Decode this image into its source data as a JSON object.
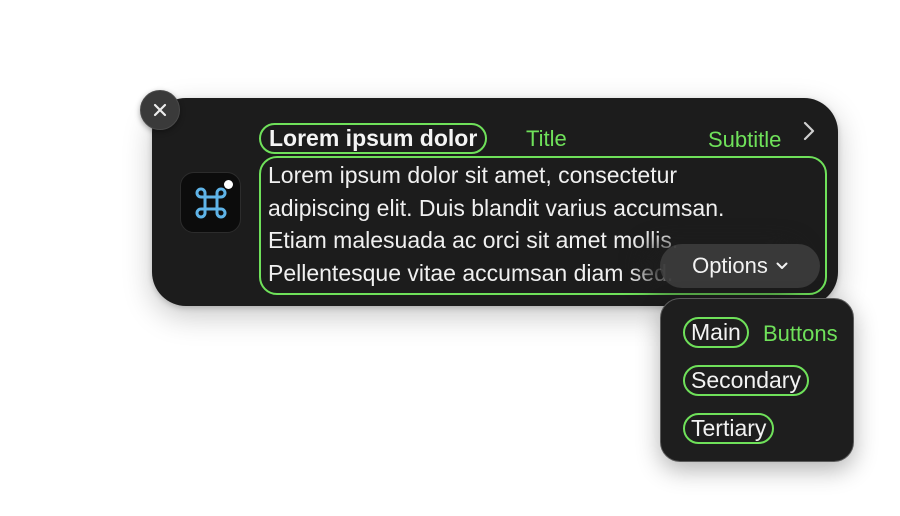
{
  "notification": {
    "title": "Lorem ipsum dolor",
    "title_annotation": "Title",
    "subtitle": "Subtitle",
    "body_lines": [
      "Lorem ipsum dolor sit amet, consectetur",
      "adipiscing elit. Duis blandit varius accumsan.",
      "Etiam malesuada ac orci sit amet mollis.",
      "Pellentesque vitae accumsan diam sed."
    ],
    "options_label": "Options"
  },
  "menu": {
    "items": [
      {
        "label": "Main"
      },
      {
        "label": "Secondary"
      },
      {
        "label": "Tertiary"
      }
    ],
    "annotation": "Buttons"
  },
  "icons": {
    "close": "close-icon",
    "app": "command-key-icon",
    "disclosure": "chevron-right-icon",
    "options": "chevron-down-icon"
  },
  "colors": {
    "annotation": "#6fe15a",
    "panel": "#1c1c1c",
    "app_icon_glyph": "#5fb4e8"
  }
}
